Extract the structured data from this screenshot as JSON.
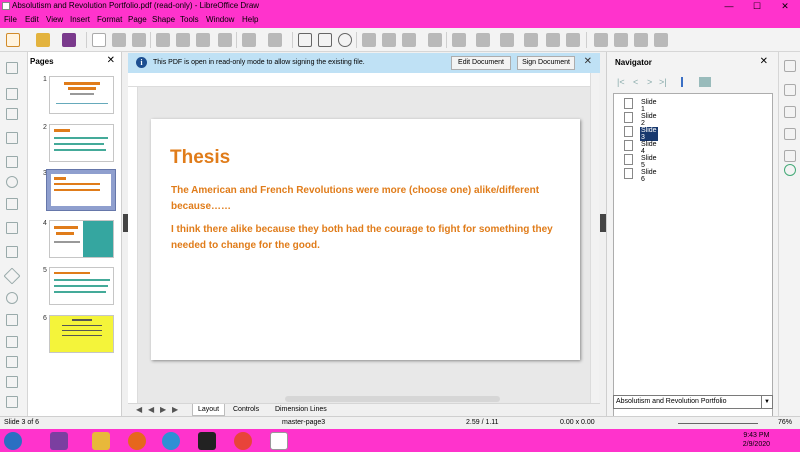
{
  "window": {
    "title": "Absolutism and Revolution Portfolio.pdf (read-only) - LibreOffice Draw",
    "controls": {
      "minimize": "—",
      "maximize": "☐",
      "close": "✕"
    }
  },
  "menu": [
    "File",
    "Edit",
    "View",
    "Insert",
    "Format",
    "Page",
    "Shape",
    "Tools",
    "Window",
    "Help"
  ],
  "pages_pane": {
    "title": "Pages",
    "close": "✕",
    "thumbnails": [
      "1",
      "2",
      "3",
      "4",
      "5",
      "6"
    ],
    "selected": 3
  },
  "infobar": {
    "message": "This PDF is open in read-only mode to allow signing the existing file.",
    "edit_button": "Edit Document",
    "sign_button": "Sign Document",
    "close": "✕"
  },
  "slide": {
    "title": "Thesis",
    "paragraph1": "The American and French Revolutions were more (choose one) alike/different because……",
    "paragraph2": "I think there alike because they both had the courage to fight for something they needed to change for the good."
  },
  "tabs": {
    "nav": [
      "◀",
      "◀",
      "▶",
      "▶"
    ],
    "items": [
      "Layout",
      "Controls",
      "Dimension Lines"
    ],
    "active": "Layout"
  },
  "navigator": {
    "title": "Navigator",
    "close": "✕",
    "items": [
      "Slide 1",
      "Slide 2",
      "Slide 3",
      "Slide 4",
      "Slide 5",
      "Slide 6"
    ],
    "selected": "Slide 3",
    "document": "Absolutism and Revolution Portfolio"
  },
  "status": {
    "slide": "Slide 3 of 6",
    "master": "master-page3",
    "position": "2.59 / 1.11",
    "size": "0.00 x 0.00",
    "zoom": "76%"
  },
  "taskbar": {
    "time": "9:43 PM",
    "date": "2/9/2020"
  },
  "colors": {
    "accent": "#ff33cc",
    "slide_text": "#e07c1a",
    "selection": "#17386e"
  }
}
